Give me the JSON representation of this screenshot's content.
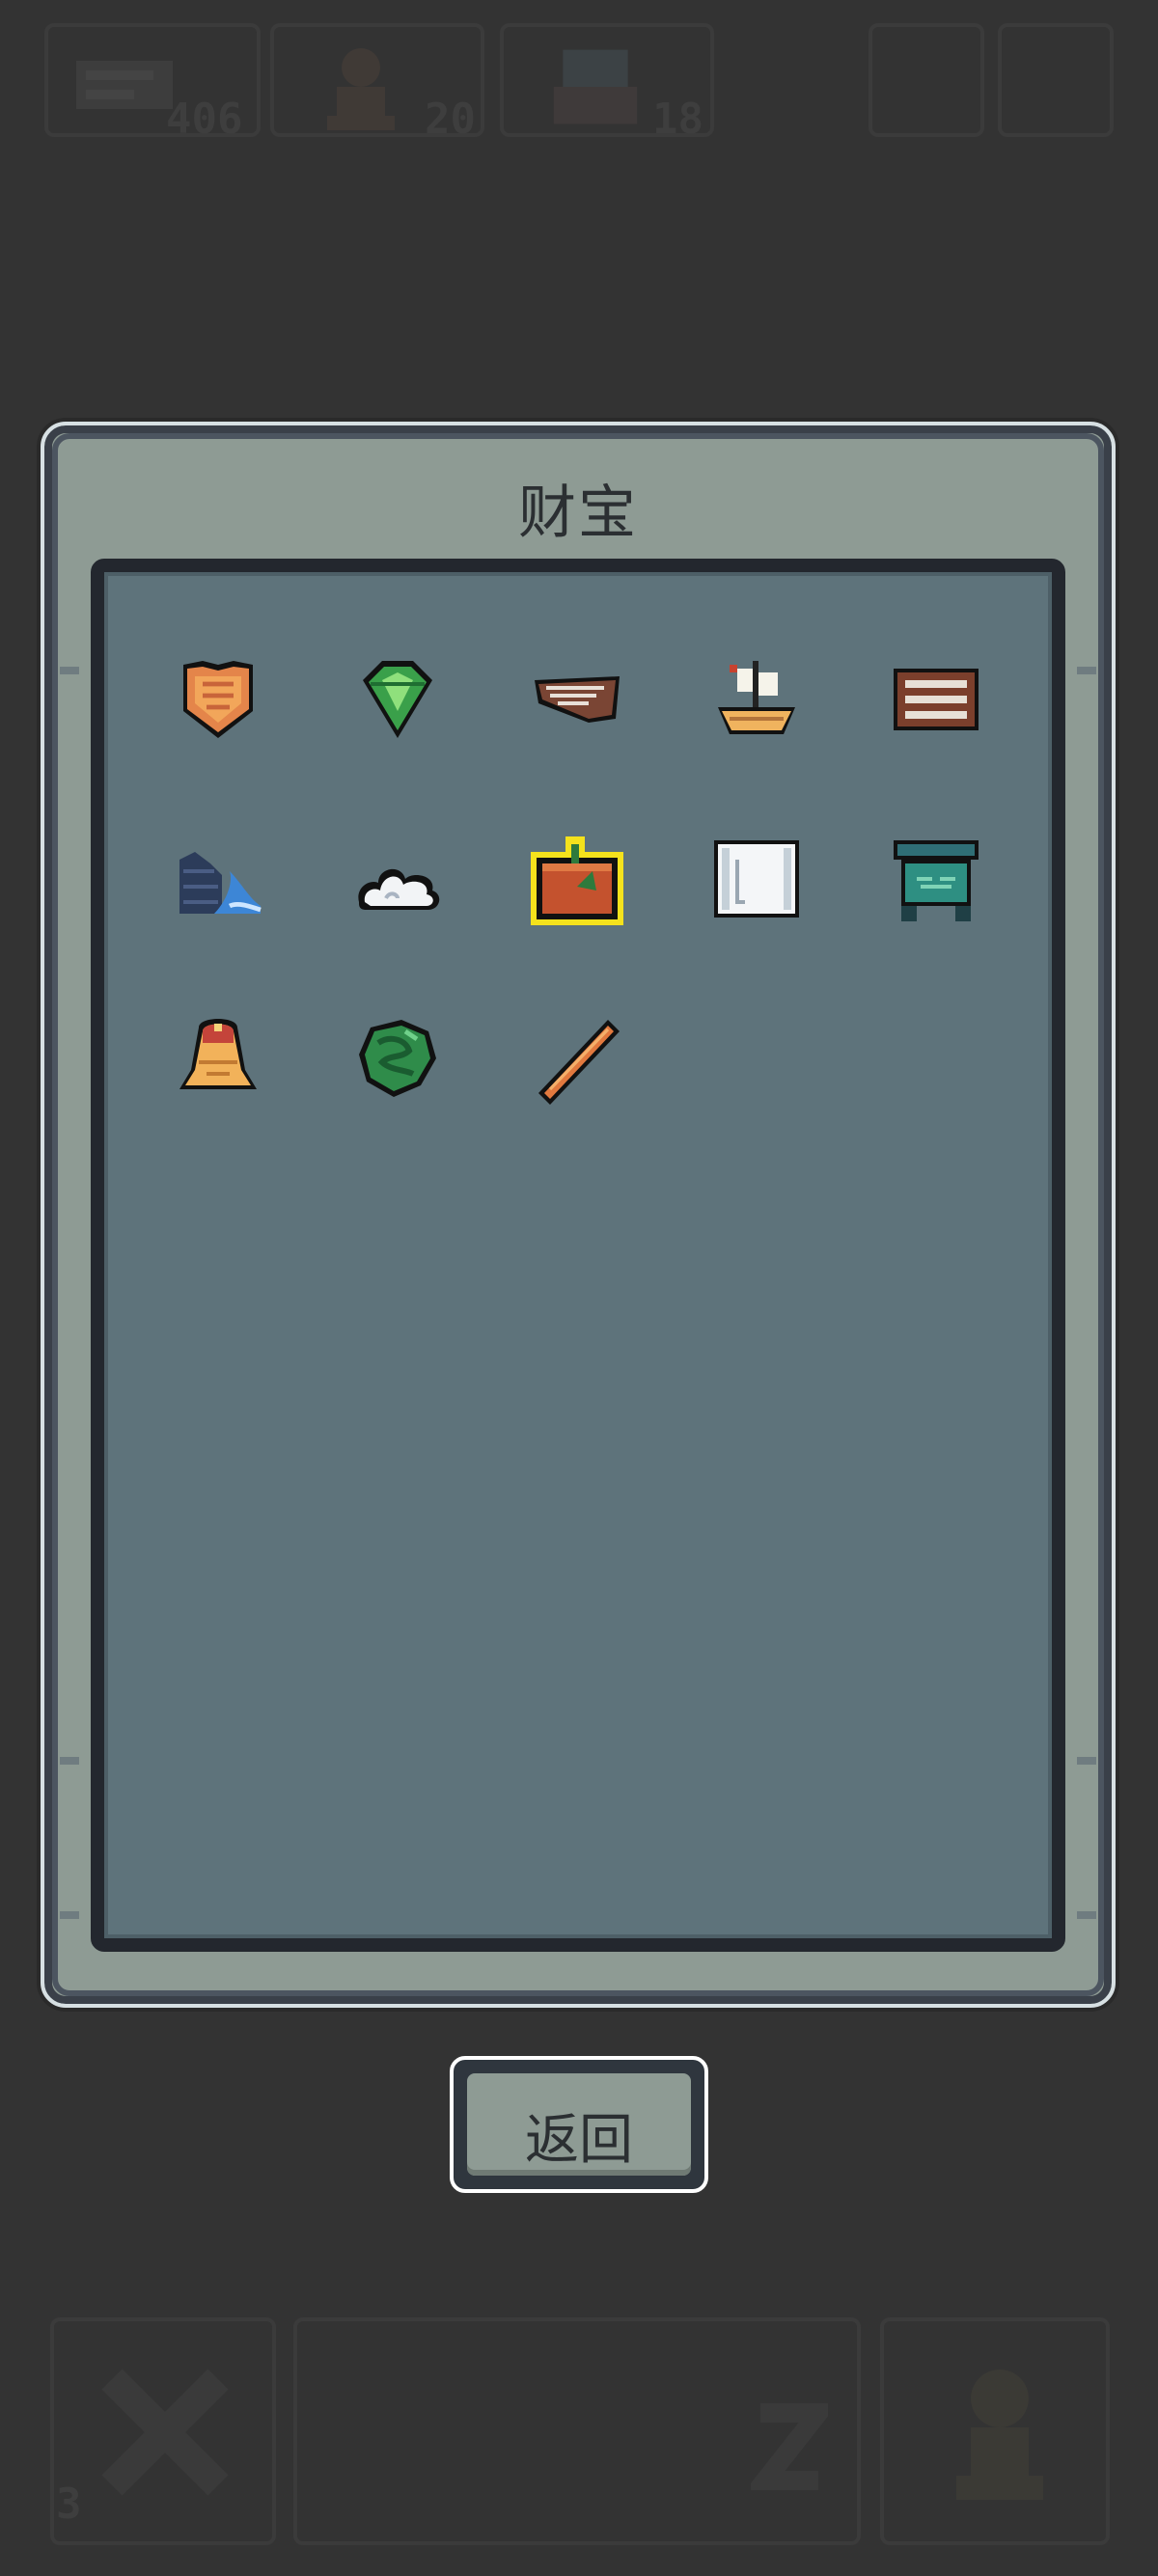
{
  "hud": {
    "stat1_value": "406",
    "stat2_value": "20",
    "stat3_value": "18",
    "bottom_count": "3",
    "stat1_icon": "scroll-icon",
    "stat2_icon": "pawn-icon",
    "stat3_icon": "monster-icon"
  },
  "modal": {
    "title": "财宝",
    "back_label": "返回"
  },
  "treasures": [
    {
      "icon": "orange-shield-icon",
      "selected": false
    },
    {
      "icon": "green-gem-icon",
      "selected": false
    },
    {
      "icon": "wooden-plank-icon",
      "selected": false
    },
    {
      "icon": "sailing-ship-icon",
      "selected": false
    },
    {
      "icon": "abacus-icon",
      "selected": false
    },
    {
      "icon": "wave-rock-icon",
      "selected": false
    },
    {
      "icon": "cloud-icon",
      "selected": false
    },
    {
      "icon": "pumpkin-chest-icon",
      "selected": true
    },
    {
      "icon": "paper-scroll-icon",
      "selected": false
    },
    {
      "icon": "teal-gate-icon",
      "selected": false
    },
    {
      "icon": "golden-bell-icon",
      "selected": false
    },
    {
      "icon": "jade-dragon-icon",
      "selected": false
    },
    {
      "icon": "wooden-staff-icon",
      "selected": false
    }
  ],
  "colors": {
    "background": "#333333",
    "panel": "#8e9b94",
    "grid": "#5e737b",
    "selection": "#f5e21c"
  }
}
